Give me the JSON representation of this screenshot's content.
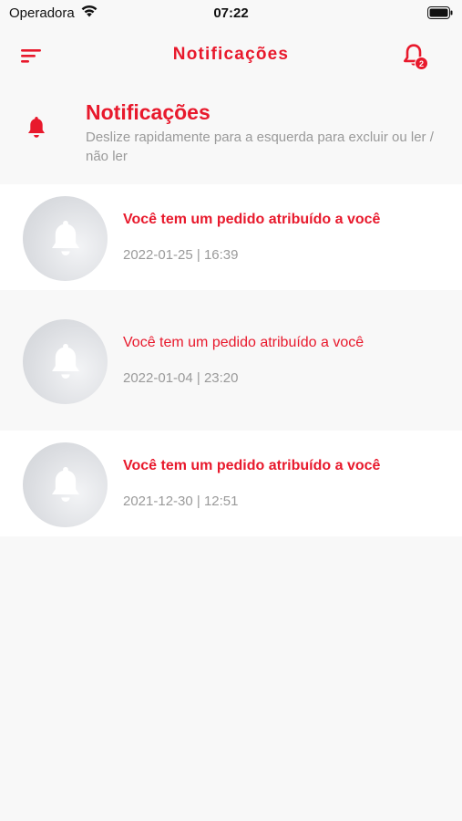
{
  "status_bar": {
    "carrier": "Operadora",
    "time": "07:22"
  },
  "nav": {
    "title": "Notificações",
    "badge_count": "2"
  },
  "header": {
    "title": "Notificações",
    "subtitle": "Deslize rapidamente para a esquerda para excluir ou ler / não ler"
  },
  "notifications": [
    {
      "title": "Você tem um pedido atribuído a você",
      "date": "2022-01-25 | 16:39",
      "read": false
    },
    {
      "title": "Você tem um pedido atribuído a você",
      "date": "2022-01-04 | 23:20",
      "read": true
    },
    {
      "title": "Você tem um pedido atribuído a você",
      "date": "2021-12-30 | 12:51",
      "read": false
    }
  ],
  "colors": {
    "accent": "#e8192c",
    "muted_text": "#9a9a9a",
    "background": "#f8f8f8"
  },
  "icons": {
    "menu": "menu-sort-icon",
    "bell": "bell-icon",
    "wifi": "wifi-icon",
    "battery": "battery-icon"
  }
}
